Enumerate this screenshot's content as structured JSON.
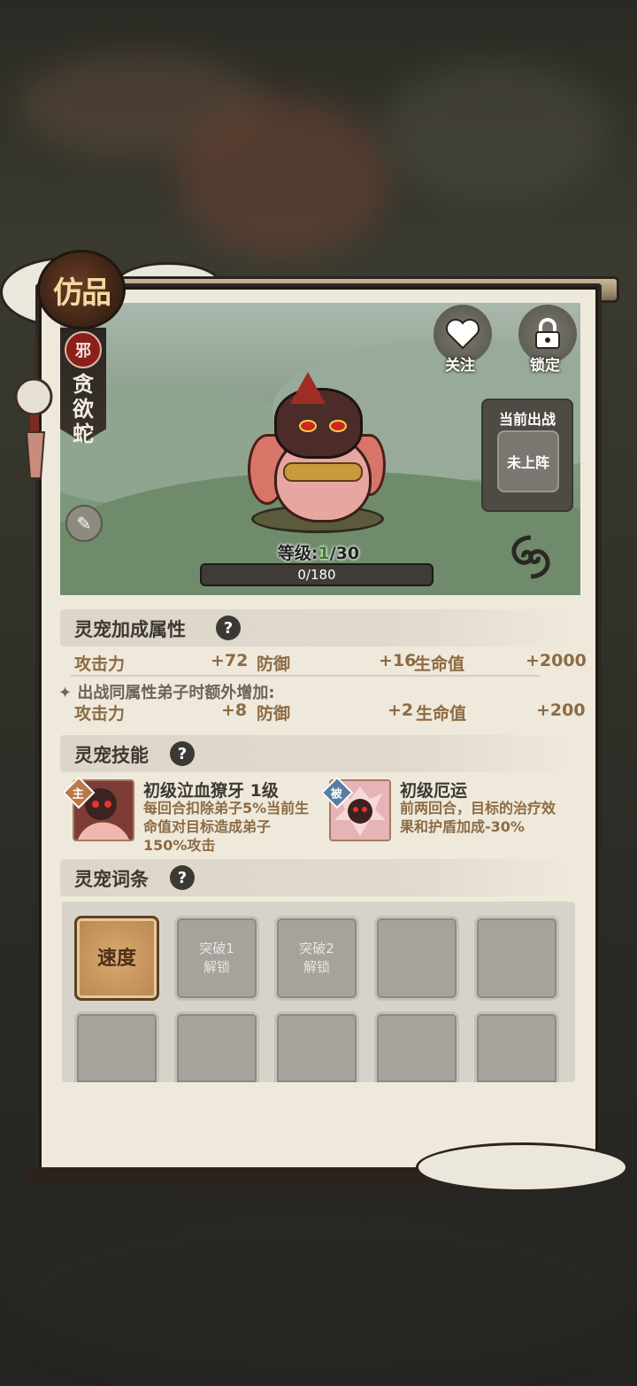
{
  "header": {
    "rank_badge": "仿品",
    "element_tag": "邪",
    "pet_name": "贪欲蛇"
  },
  "actions": {
    "follow_label": "关注",
    "lock_label": "锁定"
  },
  "deploy": {
    "title": "当前出战",
    "slot_label": "未上阵"
  },
  "level": {
    "prefix": "等级:",
    "current": "1",
    "suffix": "/30"
  },
  "exp": {
    "text": "0/180",
    "fraction": 0.0
  },
  "bonus_section": {
    "title": "灵宠加成属性",
    "help": "?",
    "stats": [
      {
        "label": "攻击力",
        "value": "+72"
      },
      {
        "label": "防御",
        "value": "+16"
      },
      {
        "label": "生命值",
        "value": "+2000"
      }
    ],
    "extra_note": "✦ 出战同属性弟子时额外增加:",
    "extra_stats": [
      {
        "label": "攻击力",
        "value": "+8"
      },
      {
        "label": "防御",
        "value": "+2"
      },
      {
        "label": "生命值",
        "value": "+200"
      }
    ]
  },
  "skills_section": {
    "title": "灵宠技能",
    "help": "?",
    "skills": [
      {
        "tag": "主",
        "name": "初级泣血獠牙 1级",
        "desc": "每回合扣除弟子5%当前生命值对目标造成弟子150%攻击"
      },
      {
        "tag": "被",
        "name": "初级厄运",
        "desc": "前两回合，目标的治疗效果和护盾加成-30%"
      }
    ]
  },
  "affix_section": {
    "title": "灵宠词条",
    "help": "?",
    "slots": [
      {
        "label": "速度"
      },
      {
        "label": "突破1\n解锁"
      },
      {
        "label": "突破2\n解锁"
      },
      {
        "label": ""
      },
      {
        "label": ""
      },
      {
        "label": ""
      },
      {
        "label": ""
      },
      {
        "label": ""
      },
      {
        "label": ""
      },
      {
        "label": ""
      }
    ]
  },
  "colors": {
    "panel": "#efe9dc",
    "stat_text": "#8c6b44",
    "level_current": "#3d7a2c",
    "evil_tag": "#8c1f1c",
    "active_slot": "#c8955b"
  },
  "icons": {
    "follow": "heart-icon",
    "lock": "lock-icon",
    "brush": "brush-icon",
    "swirl": "swirl-icon",
    "help": "question-icon"
  }
}
